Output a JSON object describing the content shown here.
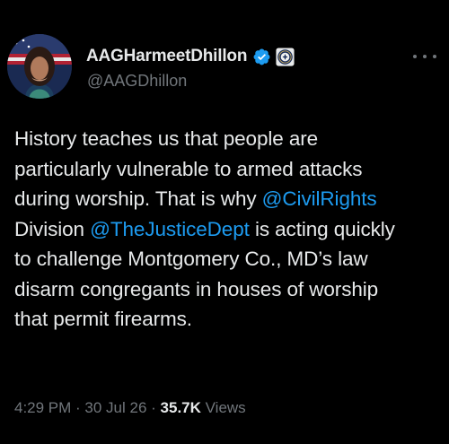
{
  "author": {
    "display_name": "AAGHarmeetDhillon",
    "handle": "@AAGDhillon",
    "avatar_icon": "profile-photo",
    "verified_icon": "verified-badge-icon",
    "affiliate_icon": "doj-seal-icon"
  },
  "menu": {
    "more_icon": "more-horizontal-icon"
  },
  "tweet": {
    "lines": [
      [
        {
          "text": "History teaches us that people are",
          "mention": false
        }
      ],
      [
        {
          "text": "particularly vulnerable to armed attacks",
          "mention": false
        }
      ],
      [
        {
          "text": "during worship. That is why ",
          "mention": false
        },
        {
          "text": "@CivilRights",
          "mention": true
        }
      ],
      [
        {
          "text": "Division ",
          "mention": false
        },
        {
          "text": "@TheJusticeDept",
          "mention": true
        },
        {
          "text": " is acting quickly",
          "mention": false
        }
      ],
      [
        {
          "text": "to challenge Montgomery Co., MD’s law",
          "mention": false
        }
      ],
      [
        {
          "text": "disarm congregants in houses of worship",
          "mention": false
        }
      ],
      [
        {
          "text": "that permit firearms.",
          "mention": false
        }
      ]
    ]
  },
  "meta": {
    "time": "4:29 PM",
    "separator": " · ",
    "date": "30 Jul 26",
    "views_count": "35.7K",
    "views_label": " Views"
  },
  "colors": {
    "background": "#000000",
    "text": "#e7e9ea",
    "secondary": "#71767b",
    "link": "#1d9bf0",
    "verified": "#1d9bf0"
  }
}
